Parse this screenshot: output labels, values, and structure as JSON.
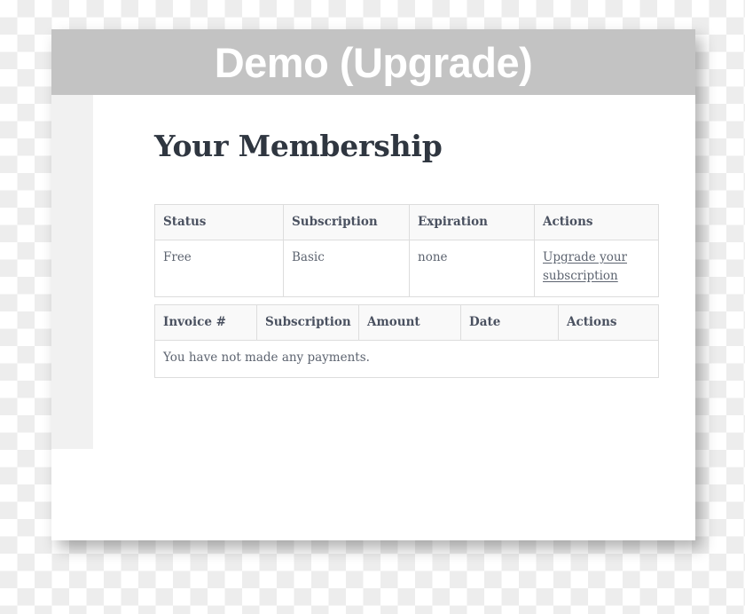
{
  "window": {
    "title": "Demo (Upgrade)"
  },
  "page": {
    "heading": "Your Membership"
  },
  "membership_table": {
    "name": "membership-table",
    "headers": [
      "Status",
      "Subscription",
      "Expiration",
      "Actions"
    ],
    "rows": [
      {
        "status": "Free",
        "subscription": "Basic",
        "expiration": "none",
        "action_label": "Upgrade your subscription"
      }
    ]
  },
  "invoices_table": {
    "name": "invoices-table",
    "headers": [
      "Invoice #",
      "Subscription",
      "Amount",
      "Date",
      "Actions"
    ],
    "empty_message": "You have not made any payments."
  },
  "colors": {
    "titlebar_background": "#c3c3c3",
    "titlebar_text": "#ffffff",
    "heading_text": "#2f3640",
    "table_border": "#dddddd",
    "table_header_background": "#f9f9f9",
    "table_text": "#5d6470",
    "sidebar_rail": "#f1f1f1"
  }
}
